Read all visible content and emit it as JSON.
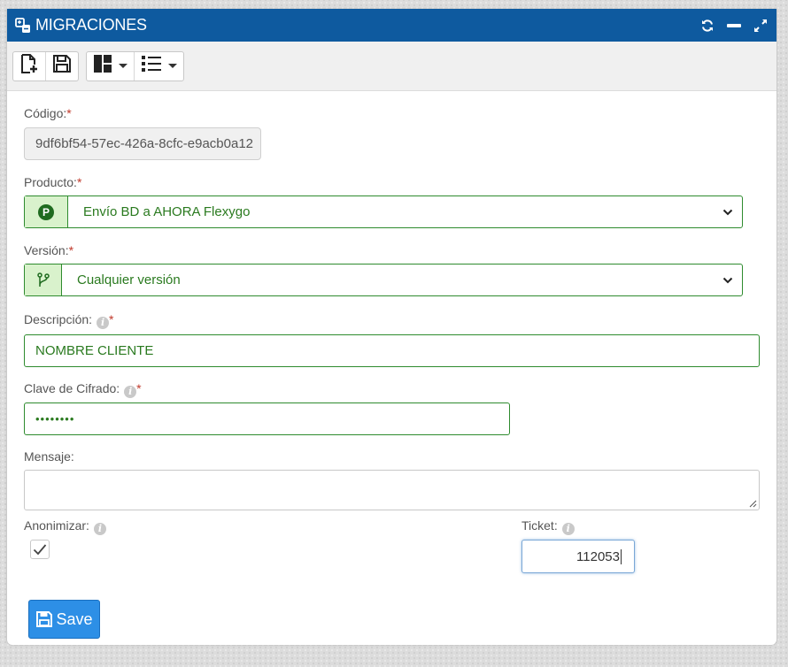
{
  "window": {
    "title": "MIGRACIONES"
  },
  "toolbar": {
    "buttons": [
      "new-document-icon",
      "save-icon",
      "layout-icon",
      "list-icon"
    ]
  },
  "form": {
    "codigo": {
      "label": "Código:",
      "required": "*",
      "value": "9df6bf54-57ec-426a-8cfc-e9acb0a12"
    },
    "producto": {
      "label": "Producto:",
      "required": "*",
      "addon": "P",
      "value": "Envío BD a AHORA Flexygo"
    },
    "version": {
      "label": "Versión:",
      "required": "*",
      "value": "Cualquier versión"
    },
    "descripcion": {
      "label": "Descripción:",
      "required": "*",
      "value": "NOMBRE CLIENTE"
    },
    "clave": {
      "label": "Clave de Cifrado:",
      "required": "*",
      "value": "••••••••"
    },
    "mensaje": {
      "label": "Mensaje:",
      "value": ""
    },
    "anonimizar": {
      "label": "Anonimizar:",
      "checked": true
    },
    "ticket": {
      "label": "Ticket:",
      "value": "112053"
    }
  },
  "save_label": "Save",
  "info_glyph": "i",
  "colors": {
    "header": "#0e5a9f",
    "accent_green": "#2e8b2e",
    "save": "#2d8fe6",
    "required": "#c0392b"
  }
}
